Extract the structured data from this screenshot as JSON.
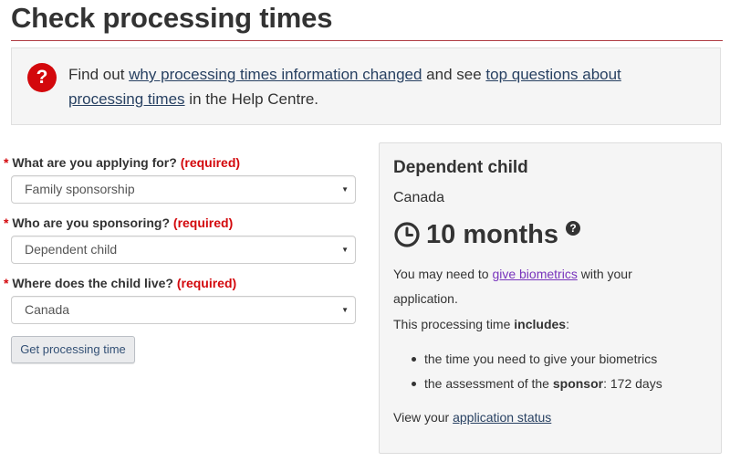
{
  "page": {
    "title": "Check processing times"
  },
  "info": {
    "text1": "Find out ",
    "link1": "why processing times information changed",
    "text2": " and see ",
    "link2": "top questions about processing times",
    "text3": " in the Help Centre."
  },
  "form": {
    "required_marker": "*",
    "required_text": "(required)",
    "fields": [
      {
        "label": "What are you applying for?",
        "value": "Family sponsorship"
      },
      {
        "label": "Who are you sponsoring?",
        "value": "Dependent child"
      },
      {
        "label": "Where does the child live?",
        "value": "Canada"
      }
    ],
    "submit_label": "Get processing time"
  },
  "result": {
    "heading": "Dependent child",
    "location": "Canada",
    "time": "10 months",
    "biometrics_pre": "You may need to ",
    "biometrics_link": "give biometrics",
    "biometrics_post": " with your",
    "biometrics_line2": "application.",
    "includes_pre": "This processing time ",
    "includes_bold": "includes",
    "includes_post": ":",
    "list": [
      {
        "text": "the time you need to give your biometrics"
      },
      {
        "pre": "the assessment of the ",
        "bold": "sponsor",
        "post": ": 172 days"
      }
    ],
    "status_pre": "View your ",
    "status_link": "application status"
  },
  "colors": {
    "accent_red": "#af3c43",
    "required_red": "#d3080c",
    "link": "#284162",
    "visited_link": "#7834bc"
  }
}
